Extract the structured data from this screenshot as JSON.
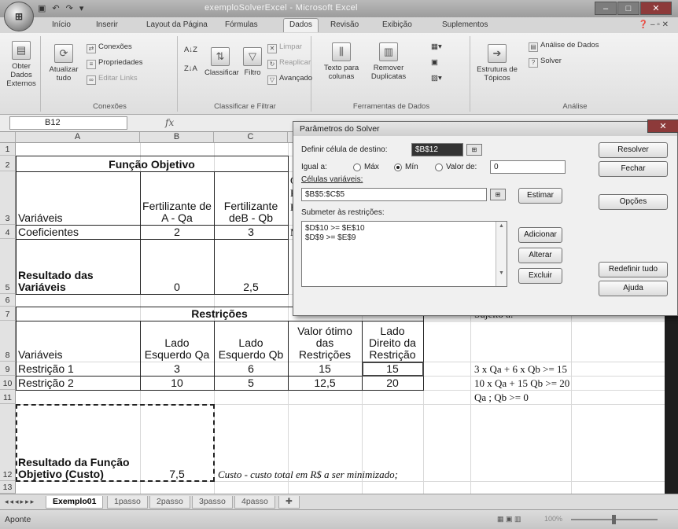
{
  "window": {
    "title": "exemploSolverExcel - Microsoft Excel",
    "office_button": "⊞"
  },
  "ribbon_tabs": [
    "Início",
    "Inserir",
    "Layout da Página",
    "Fórmulas",
    "Dados",
    "Revisão",
    "Exibição",
    "Suplementos"
  ],
  "active_tab": "Dados",
  "ribbon": {
    "obter_dados": "Obter Dados Externos",
    "atualizar": "Atualizar tudo",
    "conexoes": "Conexões",
    "propriedades": "Propriedades",
    "editar_links": "Editar Links",
    "g_conexoes": "Conexões",
    "classificar": "Classificar",
    "filtro": "Filtro",
    "limpar": "Limpar",
    "reaplicar": "Reaplicar",
    "avancado": "Avançado",
    "g_classificar": "Classificar e Filtrar",
    "texto_colunas": "Texto para colunas",
    "remover_dup": "Remover Duplicatas",
    "g_ferramentas": "Ferramentas de Dados",
    "estrutura": "Estrutura de Tópicos",
    "analise_dados": "Análise de Dados",
    "solver": "Solver",
    "g_analise": "Análise"
  },
  "formula_bar": {
    "name_box": "B12",
    "fx": "fx"
  },
  "columns": [
    "A",
    "B",
    "C",
    "D",
    "E",
    "F",
    "G",
    "H"
  ],
  "rows": [
    "1",
    "2",
    "3",
    "4",
    "5",
    "6",
    "7",
    "8",
    "9",
    "10",
    "11",
    "12",
    "13"
  ],
  "cells": {
    "funcao_objetivo": "Função Objetivo",
    "variaveis": "Variáveis",
    "fert_a": "Fertilizante de A - Qa",
    "fert_b": "Fertilizante deB - Qb",
    "coeficientes": "Coeficientes",
    "coef_a": "2",
    "coef_b": "3",
    "resultado_variaveis": "Resultado das Variáveis",
    "res_a": "0",
    "res_b": "2,5",
    "restricoes": "Restrições",
    "lado_esq_qa": "Lado Esquerdo Qa",
    "lado_esq_qb": "Lado Esquerdo Qb",
    "valor_otimo": "Valor ótimo das Restrições",
    "lado_dir": "Lado Direito da Restrição",
    "variaveis8": "Variáveis",
    "restricao1": "Restrição 1",
    "r1_qa": "3",
    "r1_qb": "6",
    "r1_otimo": "15",
    "r1_dir": "15",
    "restricao2": "Restrição 2",
    "r2_qa": "10",
    "r2_qb": "5",
    "r2_otimo": "12,5",
    "r2_dir": "20",
    "resultado_funcao": "Resultado da Função Objetivo (Custo)",
    "custo": "7,5",
    "custo_nota": "Custo - custo total em R$ a ser minimizado;",
    "sujeito": "Sujeito a:",
    "eq1": "3 x Qa + 6 x Qb >= 15",
    "eq2": "10 x Qa + 15 Qb >= 20",
    "eq3": "Qa ; Qb >= 0",
    "partial_q": "Q",
    "partial_k": "K",
    "partial_b": "B",
    "partial_m": "M"
  },
  "sheet_tabs": [
    "Exemplo01",
    "1passo",
    "2passo",
    "3passo",
    "4passo"
  ],
  "active_sheet": "Exemplo01",
  "status": {
    "mode": "Aponte",
    "zoom": "100%"
  },
  "solver": {
    "title": "Parâmetros do Solver",
    "target_label": "Definir célula de destino:",
    "target_value": "$B$12",
    "equal_label": "Igual a:",
    "max_label": "Máx",
    "min_label": "Mín",
    "value_label": "Valor de:",
    "value_field": "0",
    "selected": "Mín",
    "changing_label": "Células variáveis:",
    "changing_value": "$B$5:$C$5",
    "constraints_label": "Submeter às restrições:",
    "constraints": [
      "$D$10 >= $E$10",
      "$D$9 >= $E$9"
    ],
    "btn_resolver": "Resolver",
    "btn_fechar": "Fechar",
    "btn_estimar": "Estimar",
    "btn_opcoes": "Opções",
    "btn_adicionar": "Adicionar",
    "btn_alterar": "Alterar",
    "btn_excluir": "Excluir",
    "btn_redefinir": "Redefinir tudo",
    "btn_ajuda": "Ajuda"
  }
}
